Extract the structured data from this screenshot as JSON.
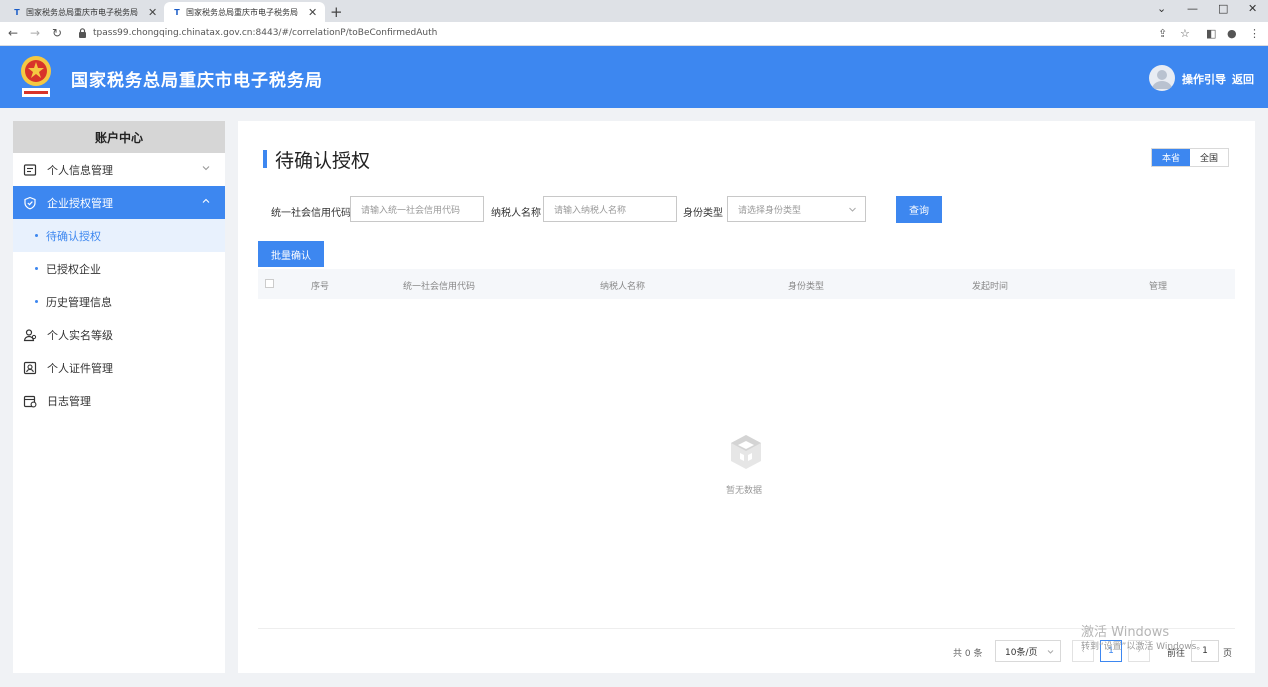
{
  "browser": {
    "tabs": [
      {
        "title": "国家税务总局重庆市电子税务局",
        "favicon": "T"
      },
      {
        "title": "国家税务总局重庆市电子税务局",
        "favicon": "T"
      }
    ],
    "url": "tpass99.chongqing.chinatax.gov.cn:8443/#/correlationP/toBeConfirmedAuth"
  },
  "header": {
    "site_title": "国家税务总局重庆市电子税务局",
    "guide_link": "操作引导",
    "back_link": "返回"
  },
  "sidebar": {
    "title": "账户中心",
    "items": [
      {
        "label": "个人信息管理"
      },
      {
        "label": "企业授权管理"
      },
      {
        "label": "待确认授权"
      },
      {
        "label": "已授权企业"
      },
      {
        "label": "历史管理信息"
      },
      {
        "label": "个人实名等级"
      },
      {
        "label": "个人证件管理"
      },
      {
        "label": "日志管理"
      }
    ]
  },
  "main": {
    "title": "待确认授权",
    "scope": {
      "local": "本省",
      "national": "全国",
      "selected": "本省"
    },
    "filters": {
      "credit_code_label": "统一社会信用代码",
      "credit_code_placeholder": "请输入统一社会信用代码",
      "taxpayer_name_label": "纳税人名称",
      "taxpayer_name_placeholder": "请输入纳税人名称",
      "identity_type_label": "身份类型",
      "identity_type_placeholder": "请选择身份类型",
      "query_button": "查询"
    },
    "batch_confirm_button": "批量确认",
    "table": {
      "columns": [
        "序号",
        "统一社会信用代码",
        "纳税人名称",
        "身份类型",
        "发起时间",
        "管理"
      ],
      "rows": []
    },
    "empty_text": "暂无数据",
    "pagination": {
      "total": "共 0 条",
      "page_size": "10条/页",
      "current_page": "1",
      "goto_prefix": "前往",
      "goto_value": "1",
      "goto_suffix": "页"
    }
  },
  "watermark": {
    "line1": "激活 Windows",
    "line2": "转到“设置”以激活 Windows。"
  },
  "colors": {
    "brand_blue": "#3d87f0",
    "header_bg": "#3d87f0",
    "page_bg": "#f0f2f5"
  }
}
